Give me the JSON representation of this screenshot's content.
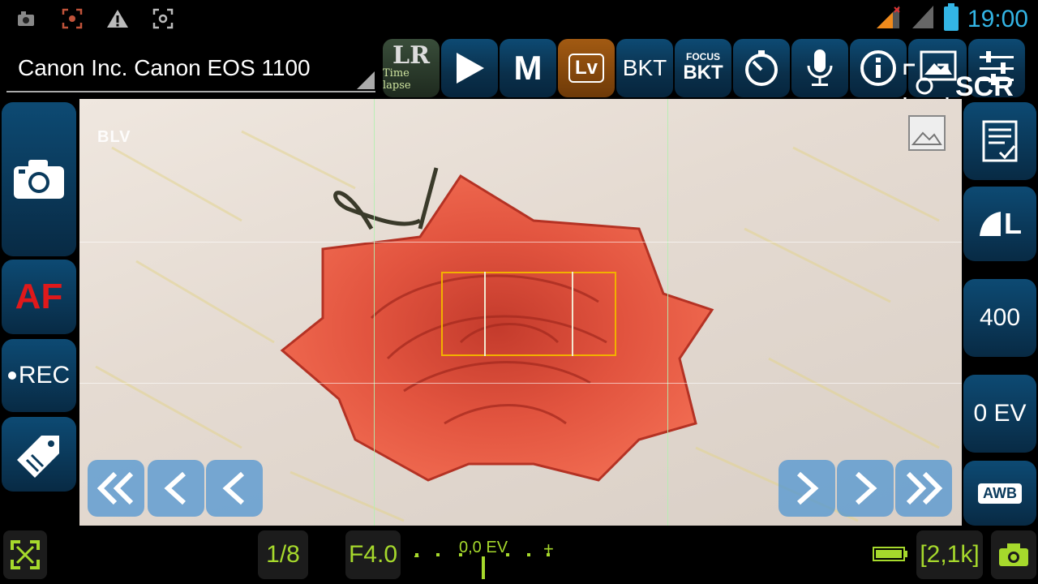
{
  "status_bar": {
    "time": "19:00",
    "icons": [
      "notification-icon",
      "screenshot-icon",
      "warning-icon",
      "focus-icon",
      "signal-icon",
      "battery-icon"
    ],
    "accent": "#33b5e5"
  },
  "header": {
    "camera_name": "Canon Inc. Canon EOS 1100"
  },
  "toolbar": {
    "lr_label_top": "LR",
    "lr_label_bottom": "Time lapse",
    "mode_label": "M",
    "lv_label": "Lv",
    "bkt_label": "BKT",
    "focus_bkt_top": "FOCUS",
    "focus_bkt_bottom": "BKT",
    "scr_label": "SCR"
  },
  "left_column": {
    "af_label": "AF",
    "rec_label": "REC"
  },
  "right_column": {
    "quality_label": "L",
    "iso_value": "400",
    "exposure_comp": "0 EV",
    "wb_label": "AWB"
  },
  "live_view": {
    "overlay_label": "BLV"
  },
  "bottom_bar": {
    "shutter": "1/8",
    "aperture": "F4.0",
    "ev_meter_label": "0,0 EV",
    "ev_minus": "-",
    "ev_plus": "+",
    "shots_remaining": "[2,1k]",
    "accent": "#a6d92c"
  }
}
